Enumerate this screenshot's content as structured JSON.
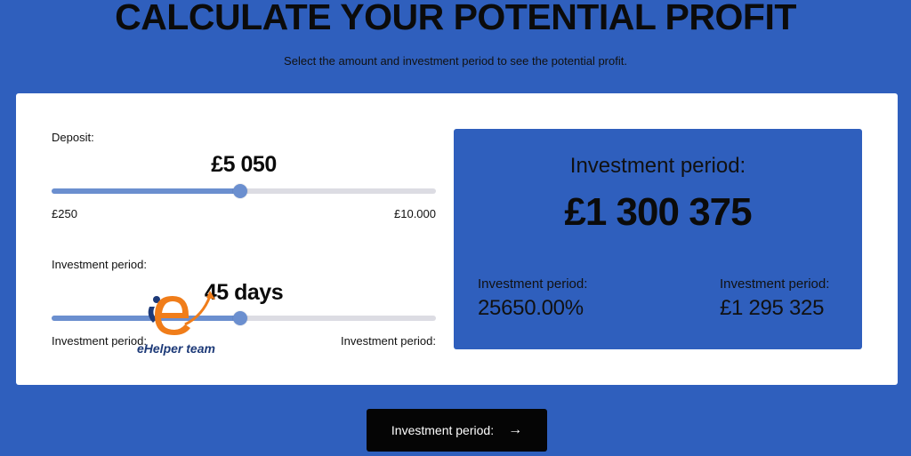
{
  "header": {
    "title": "CALCULATE YOUR POTENTIAL PROFIT",
    "subtitle": "Select the amount and investment period to see the potential profit."
  },
  "deposit": {
    "label": "Deposit:",
    "value": "£5 050",
    "min_label": "£250",
    "max_label": "£10.000",
    "fraction": 0.49
  },
  "period": {
    "label": "Investment period:",
    "value": "45 days",
    "min_label": "Investment period:",
    "max_label": "Investment period:",
    "fraction": 0.49
  },
  "result": {
    "title": "Investment period:",
    "total": "£1 300 375",
    "left_label": "Investment period:",
    "left_value": "25650.00%",
    "right_label": "Investment period:",
    "right_value": "£1 295 325"
  },
  "cta": {
    "label": "Investment period:",
    "icon": "arrow-right-icon"
  },
  "watermark": {
    "text": "eHelper team"
  },
  "colors": {
    "background": "#2f5fbd",
    "slider_fill": "#6b8fcf",
    "slider_track": "#dcdce3",
    "button": "#050505",
    "logo_orange": "#f07d1a",
    "logo_navy": "#1d3a78"
  }
}
